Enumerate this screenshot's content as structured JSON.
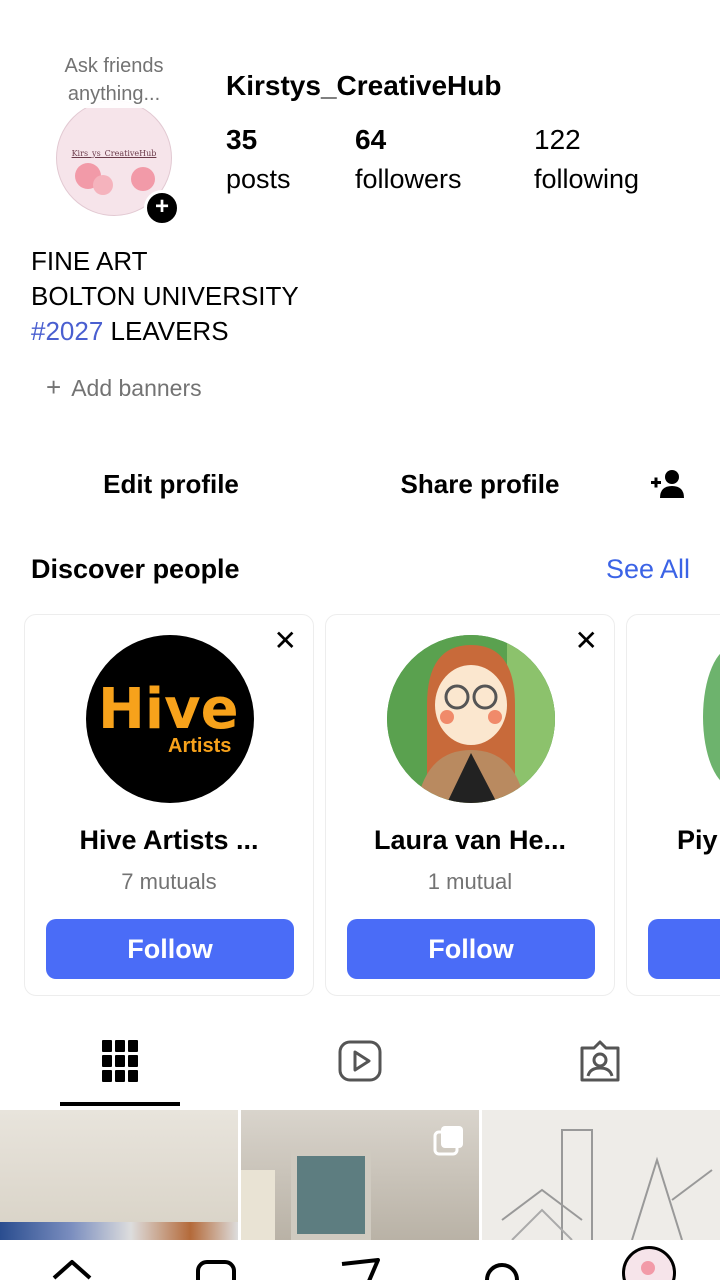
{
  "profile": {
    "note": "Ask friends anything...",
    "picture_caption": "Kirs_ys_CreativeHub",
    "username": "Kirstys_CreativeHub",
    "stats": {
      "posts": {
        "value": "35",
        "label": "posts"
      },
      "followers": {
        "value": "64",
        "label": "followers"
      },
      "following": {
        "value": "122",
        "label": "following"
      }
    },
    "bio": {
      "line1": "FINE ART",
      "line2": "BOLTON UNIVERSITY",
      "hashtag": "#2027",
      "line3_rest": " LEAVERS"
    },
    "add_banners": "Add banners",
    "add_banners_icon": "plus-icon",
    "add_story_icon": "plus-icon"
  },
  "actions": {
    "edit_profile": "Edit profile",
    "share_profile": "Share profile",
    "add_person_icon": "add-person-icon"
  },
  "discover": {
    "title": "Discover people",
    "see_all": "See All",
    "cards": [
      {
        "name": "Hive Artists ...",
        "mutuals": "7 mutuals",
        "follow": "Follow",
        "avatar_text": "Hive",
        "avatar_subtext": "Artists"
      },
      {
        "name": "Laura van He...",
        "mutuals": "1 mutual",
        "follow": "Follow"
      },
      {
        "name": "Piy",
        "follow": ""
      }
    ]
  },
  "tabs": [
    "grid-icon",
    "reels-icon",
    "tagged-icon"
  ],
  "bottom_nav": [
    "home-icon",
    "reels-icon",
    "messages-icon",
    "search-icon",
    "profile-avatar"
  ],
  "colors": {
    "accent": "#4a6cf7",
    "link": "#3b63e6",
    "hashtag": "#4a5fd0",
    "muted": "#737373"
  }
}
